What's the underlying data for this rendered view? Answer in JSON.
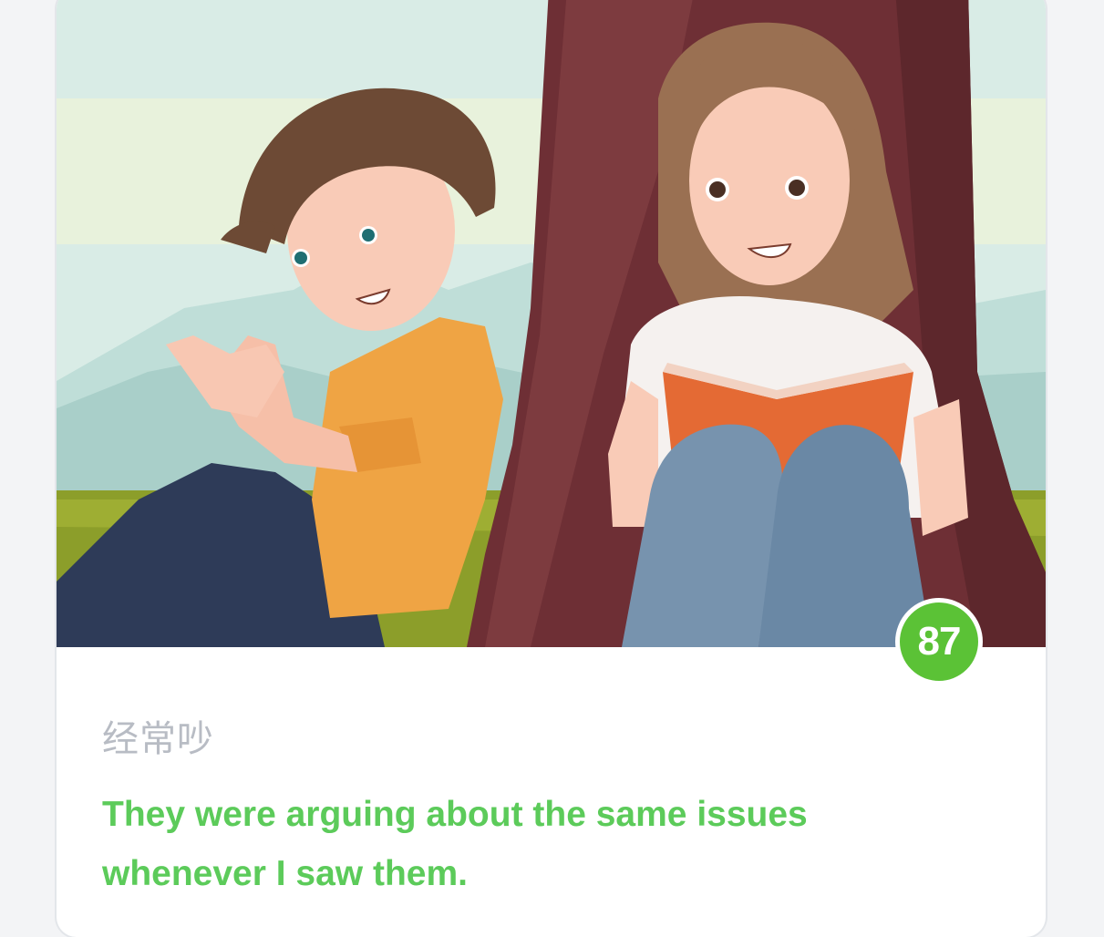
{
  "card": {
    "illustration": {
      "description_icon": "illustration-two-people-under-tree"
    },
    "score": "87",
    "phrase": "经常吵",
    "sentence": "They were arguing about the same issues whenever I saw them."
  },
  "colors": {
    "score_badge": "#5bc236",
    "sentence": "#5ccb5a",
    "phrase": "#b8bcc4"
  }
}
